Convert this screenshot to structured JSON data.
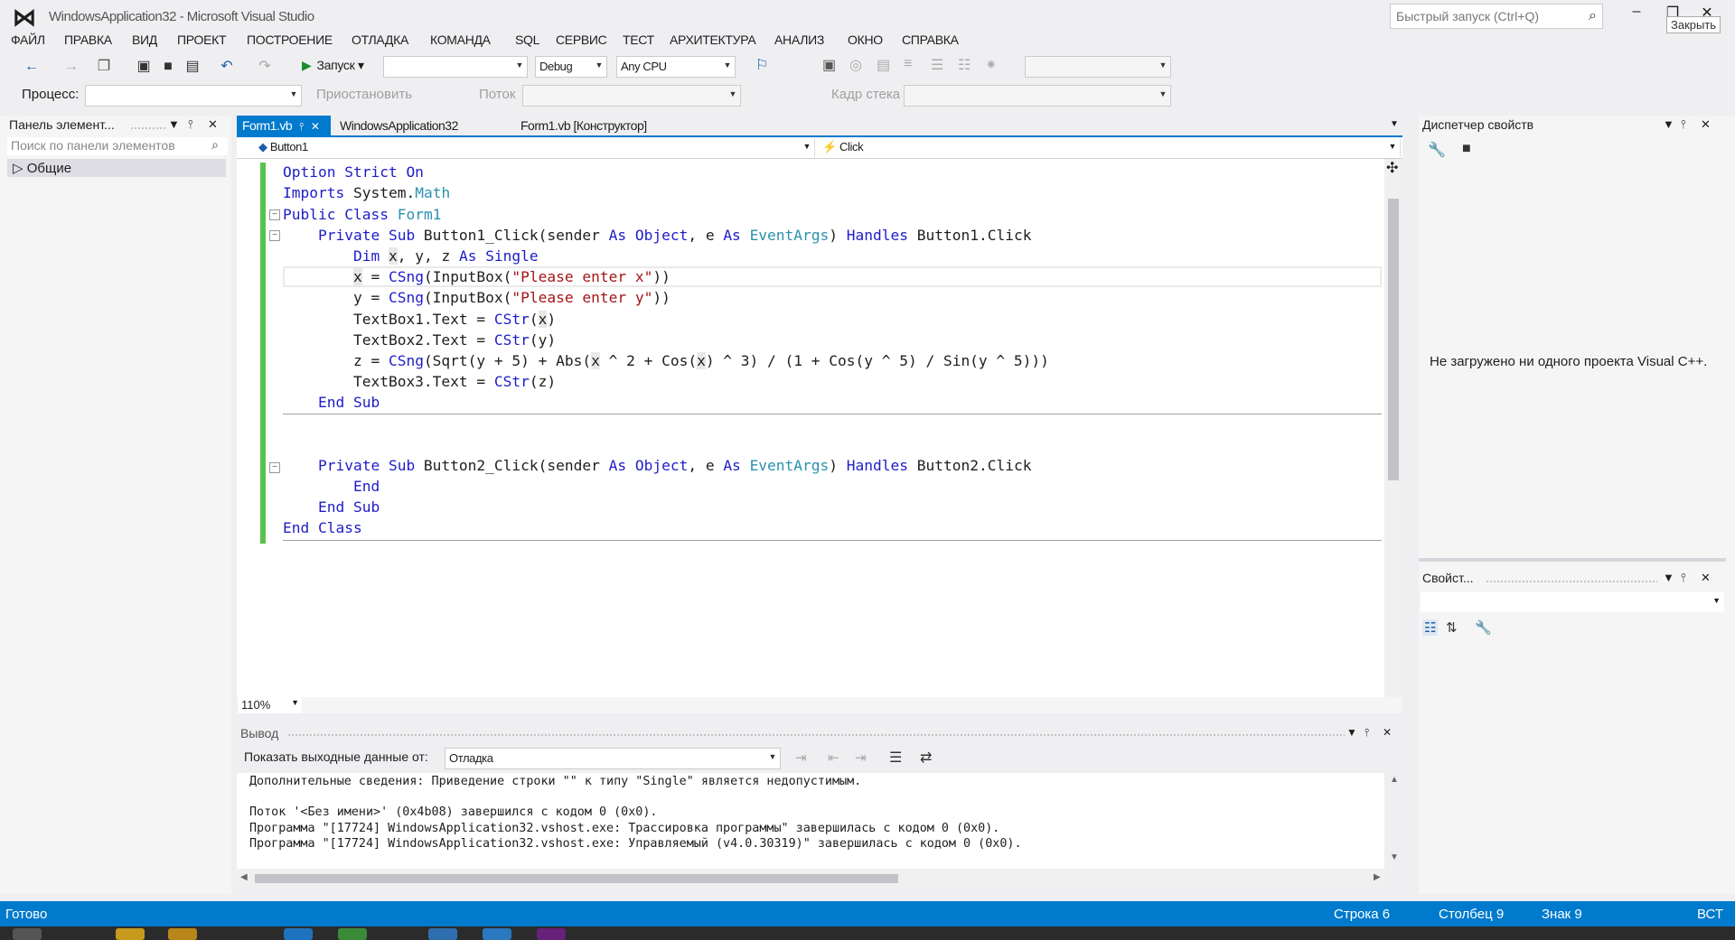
{
  "window": {
    "title": "WindowsApplication32 - Microsoft Visual Studio",
    "quick_launch_placeholder": "Быстрый запуск (Ctrl+Q)",
    "close_tooltip": "Закрыть"
  },
  "menu": [
    "ФАЙЛ",
    "ПРАВКА",
    "ВИД",
    "ПРОЕКТ",
    "ПОСТРОЕНИЕ",
    "ОТЛАДКА",
    "КОМАНДА",
    "SQL",
    "СЕРВИС",
    "ТЕСТ",
    "АРХИТЕКТУРА",
    "АНАЛИЗ",
    "ОКНО",
    "СПРАВКА"
  ],
  "toolbar": {
    "run_label": "Запуск",
    "config": "Debug",
    "platform": "Any CPU",
    "process_label": "Процесс:",
    "suspend_label": "Приостановить",
    "thread_label": "Поток",
    "stack_frame_label": "Кадр стека"
  },
  "toolbox": {
    "title": "Панель элемент...",
    "search_placeholder": "Поиск по панели элементов",
    "group": "Общие"
  },
  "tabs": [
    {
      "label": "Form1.vb",
      "active": true
    },
    {
      "label": "WindowsApplication32",
      "active": false
    },
    {
      "label": "Form1.vb [Конструктор]",
      "active": false
    }
  ],
  "navbar": {
    "object": "Button1",
    "event": "Click"
  },
  "code": {
    "zoom": "110%"
  },
  "output": {
    "title": "Вывод",
    "show_from_label": "Показать выходные данные от:",
    "source": "Отладка",
    "lines": [
      "Дополнительные сведения: Приведение строки \"\" к типу \"Single\" является недопустимым.",
      "",
      "Поток '<Без имени>' (0x4b08) завершился с кодом 0 (0x0).",
      "Программа \"[17724] WindowsApplication32.vshost.exe: Трассировка программы\" завершилась с кодом 0 (0x0).",
      "Программа \"[17724] WindowsApplication32.vshost.exe: Управляемый (v4.0.30319)\" завершилась с кодом 0 (0x0)."
    ]
  },
  "properties": {
    "dispatcher_title": "Диспетчер свойств",
    "message": "Не загружено ни одного проекта Visual C++.",
    "props_title": "Свойст..."
  },
  "status": {
    "ready": "Готово",
    "line": "Строка 6",
    "col": "Столбец 9",
    "char": "Знак 9",
    "mode": "ВСТ"
  },
  "colors": {
    "accent": "#007acc",
    "keyword": "#1d1dc8",
    "type": "#2b91af",
    "string": "#a31515",
    "change_bar": "#57c34a"
  }
}
